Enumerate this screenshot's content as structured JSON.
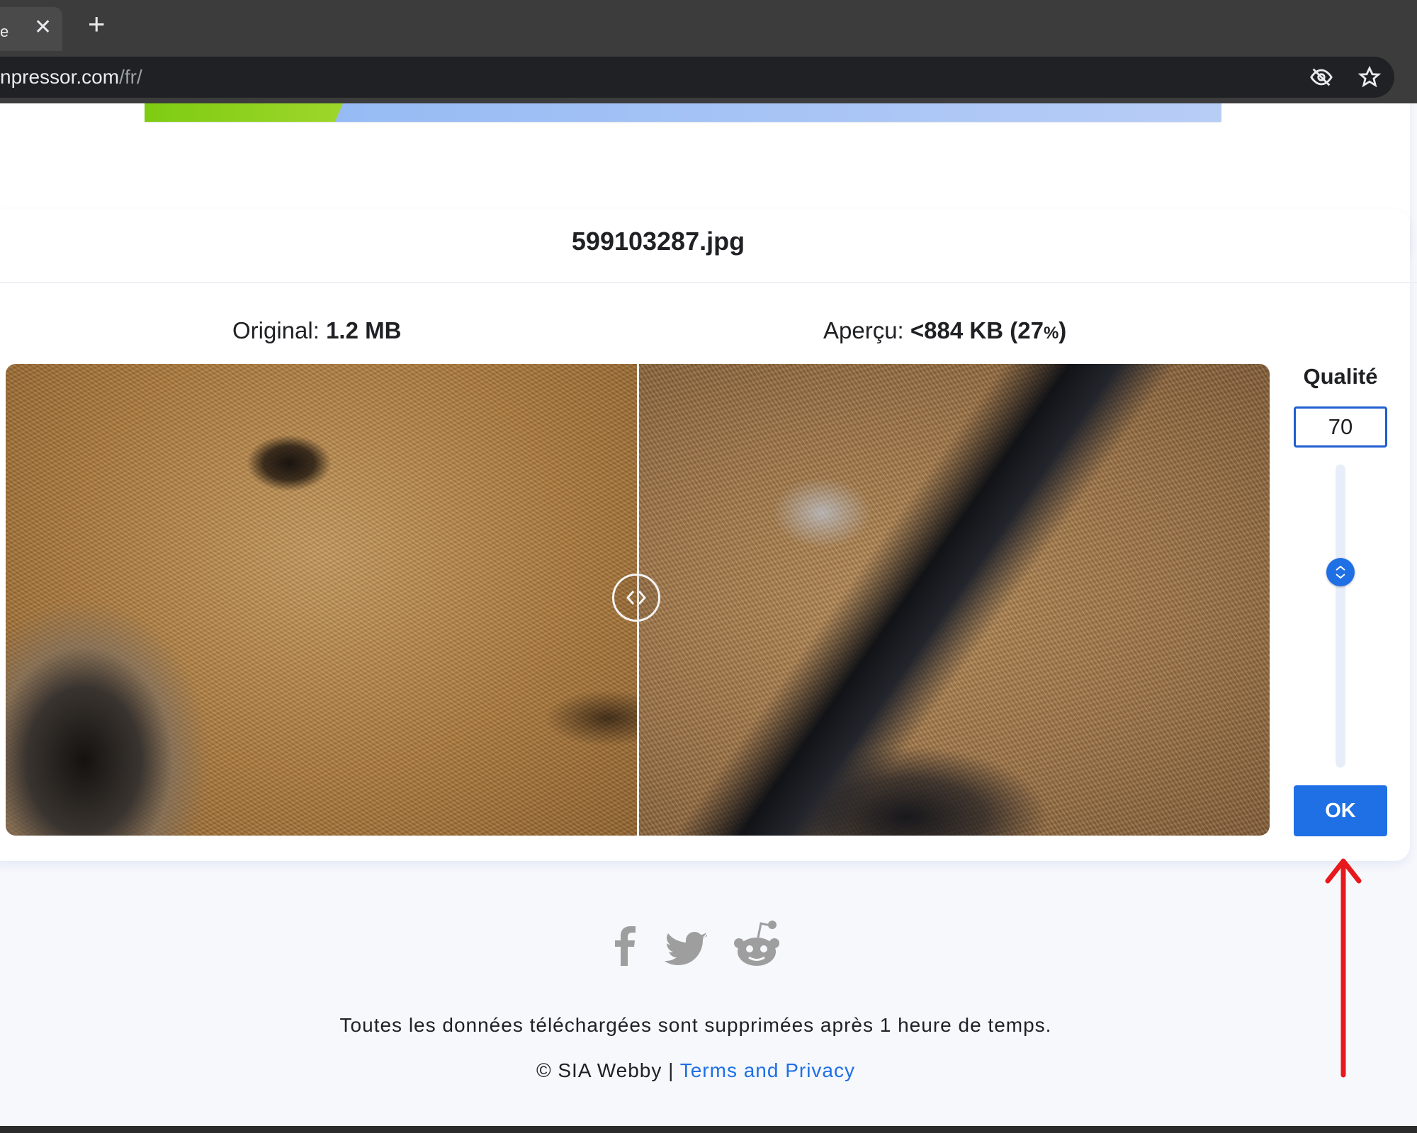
{
  "browser": {
    "tab_label": "e",
    "tab_close": "✕",
    "new_tab": "+",
    "url_main": "npressor.com",
    "url_path": "/fr/"
  },
  "main": {
    "file_name": "599103287.jpg",
    "original_label": "Original:",
    "original_size": "1.2 MB",
    "preview_label": "Aperçu:",
    "preview_size": "<884 KB (27",
    "preview_percent": "%",
    "preview_close": ")"
  },
  "quality": {
    "label": "Qualité",
    "value": "70",
    "slider_level": 70,
    "ok_label": "OK"
  },
  "footer": {
    "notice": "Toutes les données téléchargées sont supprimées après 1 heure de temps.",
    "copyright": "© SIA Webby | ",
    "terms_link": "Terms and Privacy"
  },
  "icons": {
    "hidden_eye": "eye-off-icon",
    "bookmark": "star-icon",
    "social": [
      "facebook-icon",
      "twitter-icon",
      "reddit-icon"
    ]
  },
  "colors": {
    "accent": "#1f6fe5",
    "annotation_arrow": "#e8191c",
    "social_gray": "#9e9e9e"
  }
}
